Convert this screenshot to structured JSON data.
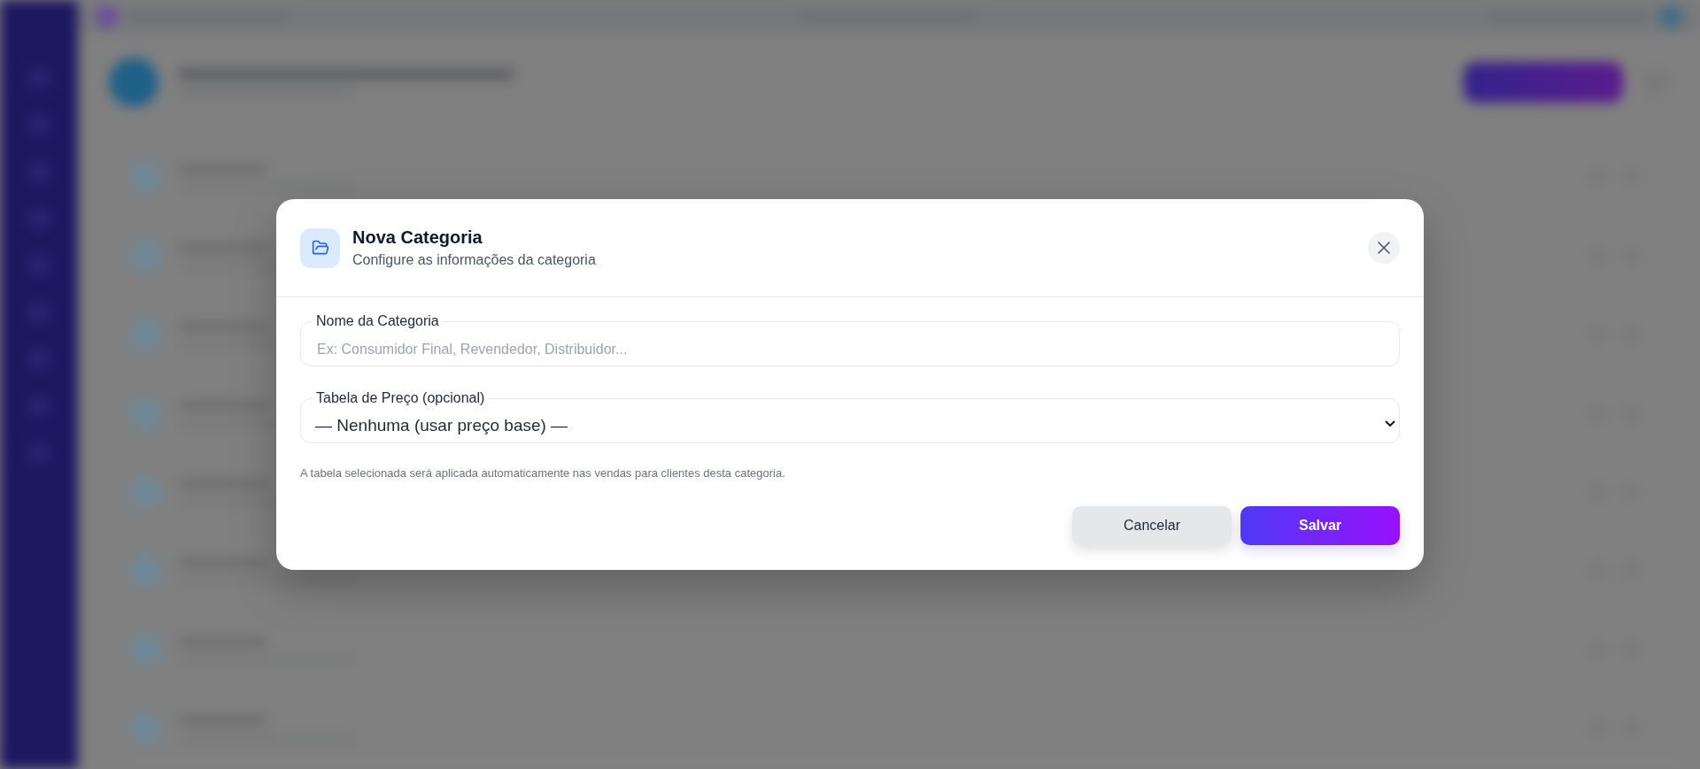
{
  "dialog": {
    "title": "Nova Categoria",
    "subtitle": "Configure as informações da categoria",
    "fields": [
      {
        "kind": "text",
        "label": "Nome da Categoria",
        "placeholder": "Ex: Consumidor Final, Revendedor, Distribuidor..."
      },
      {
        "kind": "select",
        "label": "Tabela de Preço (opcional)",
        "value": "— Nenhuma (usar preço base) —"
      }
    ],
    "help_text": "A tabela selecionada será aplicada automaticamente nas vendas para clientes desta categoria.",
    "buttons": [
      {
        "kind": "secondary",
        "label": "Cancelar"
      },
      {
        "kind": "primary",
        "label": "Salvar"
      }
    ]
  }
}
